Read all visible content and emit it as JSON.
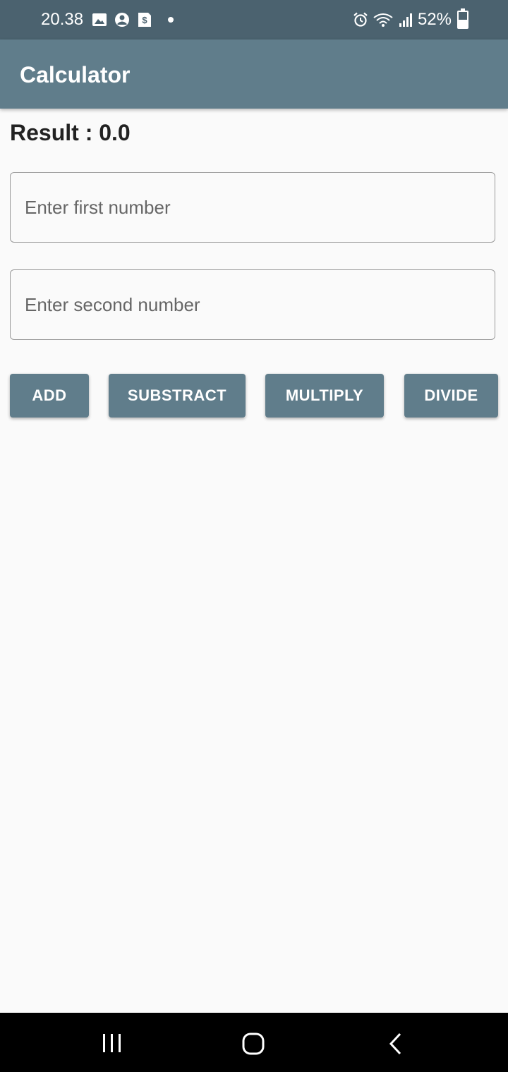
{
  "status_bar": {
    "time": "20.38",
    "left_icons": [
      "image-icon",
      "account-circle-icon",
      "dollar-app-icon",
      "notification-dot"
    ],
    "right_icons": [
      "alarm-icon",
      "wifi-icon",
      "signal-icon"
    ],
    "battery": "52%",
    "battery_level": 0.52
  },
  "app_bar": {
    "title": "Calculator"
  },
  "main": {
    "result": "Result : 0.0",
    "first_input": {
      "value": "",
      "placeholder": "Enter first number"
    },
    "second_input": {
      "value": "",
      "placeholder": "Enter second number"
    },
    "buttons": {
      "add": "ADD",
      "subtract": "SUBSTRACT",
      "multiply": "MULTIPLY",
      "divide": "DIVIDE"
    }
  },
  "nav_bar": {
    "icons": [
      "recent-apps-icon",
      "home-icon",
      "back-icon"
    ]
  },
  "colors": {
    "status_bar": "#4b626f",
    "app_bar": "#607d8b",
    "button": "#607d8b",
    "background": "#fafafa",
    "nav_bar": "#000000"
  }
}
